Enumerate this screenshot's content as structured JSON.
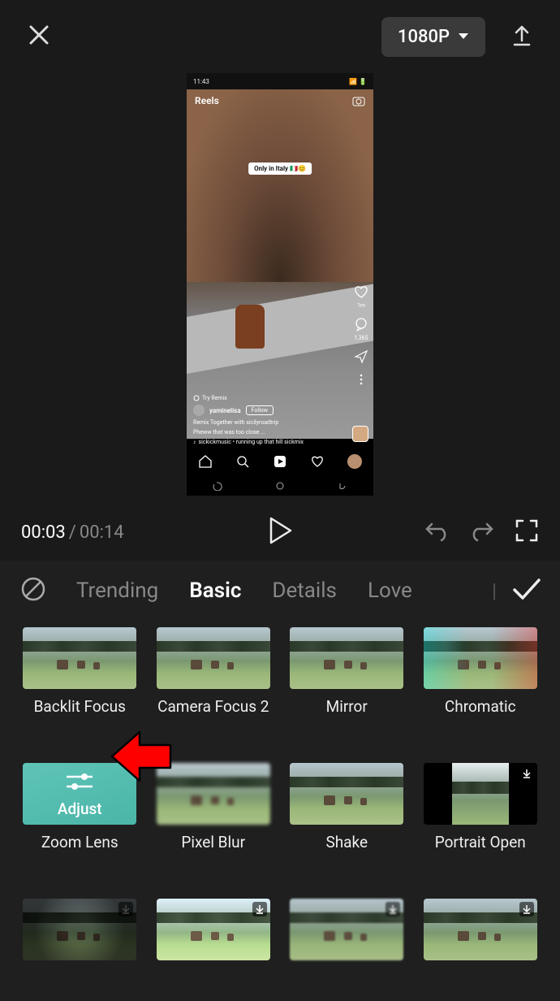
{
  "topbar": {
    "resolution_label": "1080P"
  },
  "preview": {
    "status_time": "11:43",
    "app_header": "Reels",
    "overlay_pill": "Only in Italy 🇮🇹😊",
    "like_count": "1m",
    "comment_count": "1,365",
    "try_remix": "Try Remix",
    "username": "yaminelisa",
    "follow_label": "Follow",
    "remix_line": "Remix Together with sicilyroadtrip",
    "caption": "Pheww that was too close ...",
    "music": "sickickmusic • running up that hill sickmix"
  },
  "player": {
    "current": "00:03",
    "total": "00:14"
  },
  "tabs": [
    {
      "id": "trending",
      "label": "Trending",
      "active": false
    },
    {
      "id": "basic",
      "label": "Basic",
      "active": true
    },
    {
      "id": "details",
      "label": "Details",
      "active": false
    },
    {
      "id": "love",
      "label": "Love",
      "active": false
    }
  ],
  "selected_overlay_label": "Adjust",
  "effects": [
    {
      "id": "backlit-focus",
      "label": "Backlit Focus",
      "selected": false,
      "download": false,
      "variant": ""
    },
    {
      "id": "camera-focus-2",
      "label": "Camera Focus 2",
      "selected": false,
      "download": false,
      "variant": ""
    },
    {
      "id": "mirror",
      "label": "Mirror",
      "selected": false,
      "download": false,
      "variant": ""
    },
    {
      "id": "chromatic",
      "label": "Chromatic",
      "selected": false,
      "download": false,
      "variant": "chromatic"
    },
    {
      "id": "zoom-lens",
      "label": "Zoom Lens",
      "selected": true,
      "download": false,
      "variant": ""
    },
    {
      "id": "pixel-blur",
      "label": "Pixel Blur",
      "selected": false,
      "download": false,
      "variant": "blur"
    },
    {
      "id": "shake",
      "label": "Shake",
      "selected": false,
      "download": false,
      "variant": "shake"
    },
    {
      "id": "portrait-open",
      "label": "Portrait Open",
      "selected": false,
      "download": true,
      "variant": "portrait"
    },
    {
      "id": "row3-1",
      "label": "",
      "selected": false,
      "download": true,
      "variant": "dim partial-dim"
    },
    {
      "id": "row3-2",
      "label": "",
      "selected": false,
      "download": true,
      "variant": "bright2"
    },
    {
      "id": "row3-3",
      "label": "",
      "selected": false,
      "download": true,
      "variant": "motion"
    },
    {
      "id": "row3-4",
      "label": "",
      "selected": false,
      "download": true,
      "variant": ""
    }
  ]
}
